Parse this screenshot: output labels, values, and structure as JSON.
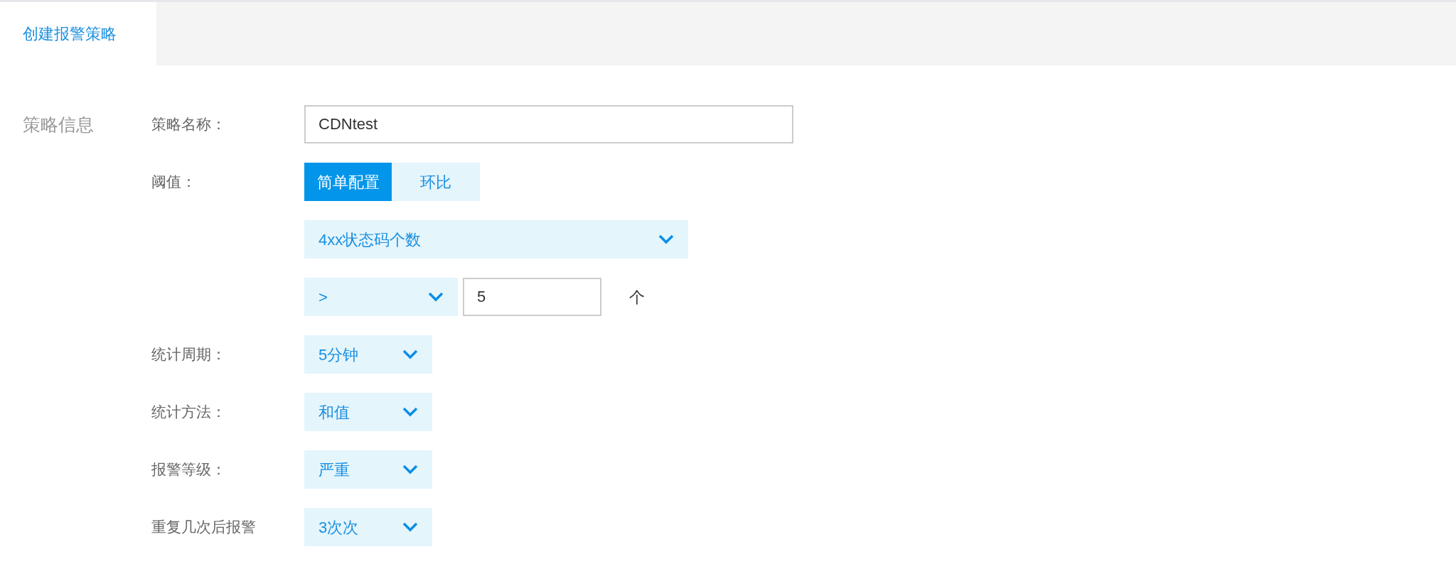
{
  "tabs": [
    {
      "label": "创建报警策略",
      "selected": true
    }
  ],
  "section": "策略信息",
  "rows": [
    {
      "label": "策略名称：",
      "controls": [
        {
          "kind": "input",
          "value": "CDNtest"
        }
      ]
    },
    {
      "label": "阈值：",
      "controls": [
        {
          "kind": "segmented",
          "options": [
            {
              "label": "简单配置",
              "selected": true
            },
            {
              "label": "环比",
              "selected": false
            }
          ]
        }
      ]
    },
    {
      "controls": [
        {
          "kind": "metric",
          "value": "4xx状态码个数"
        }
      ]
    },
    {
      "controls": [
        {
          "kind": "operator",
          "value": ">"
        },
        {
          "kind": "number",
          "value": "5"
        },
        {
          "kind": "unit",
          "text": "个"
        }
      ]
    },
    {
      "label": "统计周期：",
      "controls": [
        {
          "kind": "select",
          "value": "5分钟"
        }
      ]
    },
    {
      "label": "统计方法：",
      "controls": [
        {
          "kind": "select",
          "value": "和值"
        }
      ]
    },
    {
      "label": "报警等级：",
      "controls": [
        {
          "kind": "select",
          "value": "严重"
        }
      ]
    },
    {
      "label": "重复几次后报警",
      "controls": [
        {
          "kind": "select",
          "value": "3次次"
        }
      ]
    }
  ]
}
